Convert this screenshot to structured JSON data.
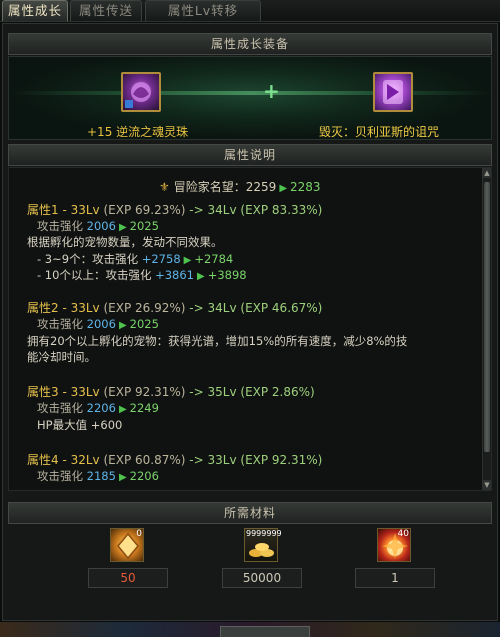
{
  "tabs": [
    {
      "label": "属性成长"
    },
    {
      "label": "属性传送"
    },
    {
      "label": "属性Lv转移"
    }
  ],
  "equip": {
    "header": "属性成长装备",
    "left_name": "+15 逆流之魂灵珠",
    "right_name": "毁灭：贝利亚斯的诅咒",
    "plus": "+"
  },
  "description": {
    "header": "属性说明",
    "fame_label": "冒险家名望：",
    "fame_from": "2259",
    "fame_to": "2283"
  },
  "attrs": [
    {
      "title": "属性1 - 33Lv",
      "exp": "(EXP 69.23%)",
      "arrow": "->",
      "next": "34Lv (EXP 83.33%)",
      "stat_label": "攻击强化",
      "stat_from": "2006",
      "stat_to": "2025",
      "desc": "根据孵化的宠物数量，发动不同效果。",
      "sub1_label": "- 3~9个：攻击强化",
      "sub1_from": "+2758",
      "sub1_to": "+2784",
      "sub2_label": "- 10个以上：攻击强化",
      "sub2_from": "+3861",
      "sub2_to": "+3898"
    },
    {
      "title": "属性2 - 33Lv",
      "exp": "(EXP 26.92%)",
      "arrow": "->",
      "next": "34Lv (EXP 46.67%)",
      "stat_label": "攻击强化",
      "stat_from": "2006",
      "stat_to": "2025",
      "desc1": "拥有20个以上孵化的宠物：获得光谱，增加15%的所有速度，减少8%的技",
      "desc2": "能冷却时间。"
    },
    {
      "title": "属性3 - 33Lv",
      "exp": "(EXP 92.31%)",
      "arrow": "->",
      "next": "35Lv (EXP 2.86%)",
      "stat_label": "攻击强化",
      "stat_from": "2206",
      "stat_to": "2249",
      "extra": "HP最大值 +600"
    },
    {
      "title": "属性4 - 32Lv",
      "exp": "(EXP 60.87%)",
      "arrow": "->",
      "next": "33Lv (EXP 92.31%)",
      "stat_label": "攻击强化",
      "stat_from": "2185",
      "stat_to": "2206"
    }
  ],
  "materials": {
    "header": "所需材料",
    "items": [
      {
        "count": "50",
        "badge": "0"
      },
      {
        "count": "50000",
        "badge": "9999999"
      },
      {
        "count": "1",
        "badge": "40"
      }
    ]
  },
  "colors": {
    "accent_gold": "#e6c04b",
    "up_green": "#7bd36a",
    "value_blue": "#5fb4e8",
    "insufficient_red": "#e85a3a"
  }
}
